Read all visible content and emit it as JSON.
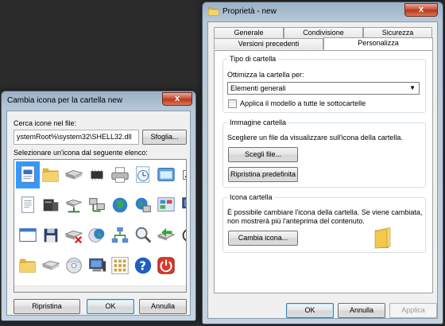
{
  "change_icon_dialog": {
    "title": "Cambia icona per la cartella new",
    "close_label": "x",
    "search_label": "Cerca icone nel file:",
    "search_value": "ystemRoot%\\system32\\SHELL32.dll",
    "browse_label": "Sfoglia...",
    "select_label": "Selezionare un'icona dal seguente elenco:",
    "icons": [
      [
        "document-icon",
        "folder-icon",
        "hard-drive-icon",
        "chip-icon",
        "printer-icon",
        "clock-icon",
        "window-icon",
        "arrow-icon"
      ],
      [
        "text-file-icon",
        "tower-computer-icon",
        "network-drive-icon",
        "network-icon",
        "globe-icon",
        "globe-network-icon",
        "control-panel-icon",
        "monitor-icon"
      ],
      [
        "window-blank-icon",
        "floppy-disk-icon",
        "disconnect-drive-icon",
        "cd-globe-icon",
        "network-tree-icon",
        "magnifier-icon",
        "arrow-drive-icon",
        "cd-icon"
      ],
      [
        "folder-icon",
        "tape-drive-icon",
        "cd-drive-icon",
        "computer-icon",
        "grid-icon",
        "help-icon",
        "power-icon",
        "blank-icon"
      ]
    ],
    "buttons": {
      "restore": "Ripristina",
      "ok": "OK",
      "cancel": "Annulla"
    }
  },
  "properties_dialog": {
    "title": "Proprietà - new",
    "close_label": "x",
    "tabs_row1": [
      "Generale",
      "Condivisione",
      "Sicurezza"
    ],
    "tabs_row2": [
      "Versioni precedenti",
      "Personalizza"
    ],
    "active_tab": "Personalizza",
    "folder_type": {
      "title": "Tipo di cartella",
      "optimize_label": "Ottimizza la cartella per:",
      "optimize_value": "Elementi generali",
      "apply_template_label": "Applica il modello a tutte le sottocartelle",
      "apply_template_checked": false
    },
    "folder_image": {
      "title": "Immagine cartella",
      "description": "Scegliere un file da visualizzare sull'icona della cartella.",
      "choose_file": "Scegli file...",
      "restore_default": "Ripristina predefinita"
    },
    "folder_icon": {
      "title": "Icona cartella",
      "description_1": "È possibile cambiare l'icona della cartella. Se viene cambiata,",
      "description_2": "non mostrerà più l'anteprima del contenuto.",
      "change_icon": "Cambia icona..."
    },
    "buttons": {
      "ok": "OK",
      "cancel": "Annulla",
      "apply": "Applica"
    }
  },
  "colors": {
    "selection": "#3399ff",
    "folder": "#f2c94c",
    "close_button": "#c7492d"
  }
}
